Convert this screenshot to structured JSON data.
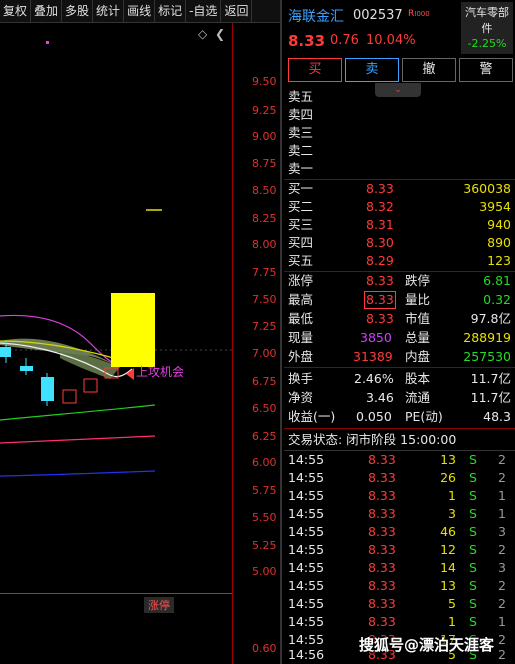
{
  "toolbar": [
    "复权",
    "叠加",
    "多股",
    "统计",
    "画线",
    "标记",
    "-自选",
    "返回"
  ],
  "stock": {
    "name": "海联金汇",
    "code": "002537",
    "badge": "R",
    "price": "8.33",
    "change": "0.76",
    "change_pct": "10.04%",
    "sector_name": "汽车零部件",
    "sector_pct": "-2.25%"
  },
  "actions": {
    "buy": "买",
    "sell": "卖",
    "cancel": "撤",
    "alert": "警"
  },
  "chart": {
    "y_ticks": [
      "9.50",
      "9.25",
      "9.00",
      "8.75",
      "8.50",
      "8.25",
      "8.00",
      "7.75",
      "7.50",
      "7.25",
      "7.00",
      "6.75",
      "6.50",
      "6.25",
      "6.00",
      "5.75",
      "5.50",
      "5.25",
      "5.00"
    ],
    "volume_tick": "0.60",
    "annotation": "上攻机会",
    "limit_tag": "涨停",
    "diamond": "◇",
    "scroll": "❮"
  },
  "sell_levels": [
    "卖五",
    "卖四",
    "卖三",
    "卖二",
    "卖一"
  ],
  "buy_levels": [
    {
      "label": "买一",
      "price": "8.33",
      "vol": "360038"
    },
    {
      "label": "买二",
      "price": "8.32",
      "vol": "3954"
    },
    {
      "label": "买三",
      "price": "8.31",
      "vol": "940"
    },
    {
      "label": "买四",
      "price": "8.30",
      "vol": "890"
    },
    {
      "label": "买五",
      "price": "8.29",
      "vol": "123"
    }
  ],
  "stats": [
    {
      "l1": "涨停",
      "v1": "8.33",
      "l2": "跌停",
      "v2": "6.81"
    },
    {
      "l1": "最高",
      "v1": "8.33",
      "l2": "量比",
      "v2": "0.32"
    },
    {
      "l1": "最低",
      "v1": "8.33",
      "l2": "市值",
      "v2": "97.8亿"
    },
    {
      "l1": "现量",
      "v1": "3850",
      "l2": "总量",
      "v2": "288919"
    },
    {
      "l1": "外盘",
      "v1": "31389",
      "l2": "内盘",
      "v2": "257530"
    }
  ],
  "fundamentals": [
    {
      "l1": "换手",
      "v1": "2.46%",
      "l2": "股本",
      "v2": "11.7亿"
    },
    {
      "l1": "净资",
      "v1": "3.46",
      "l2": "流通",
      "v2": "11.7亿"
    },
    {
      "l1": "收益(一)",
      "v1": "0.050",
      "l2": "PE(动)",
      "v2": "48.3"
    }
  ],
  "trade_status": "交易状态: 闭市阶段 15:00:00",
  "ticks": [
    {
      "time": "14:55",
      "price": "8.33",
      "vol": "13",
      "side": "S",
      "n": "2"
    },
    {
      "time": "14:55",
      "price": "8.33",
      "vol": "26",
      "side": "S",
      "n": "2"
    },
    {
      "time": "14:55",
      "price": "8.33",
      "vol": "1",
      "side": "S",
      "n": "1"
    },
    {
      "time": "14:55",
      "price": "8.33",
      "vol": "3",
      "side": "S",
      "n": "1"
    },
    {
      "time": "14:55",
      "price": "8.33",
      "vol": "46",
      "side": "S",
      "n": "3"
    },
    {
      "time": "14:55",
      "price": "8.33",
      "vol": "12",
      "side": "S",
      "n": "2"
    },
    {
      "time": "14:55",
      "price": "8.33",
      "vol": "14",
      "side": "S",
      "n": "3"
    },
    {
      "time": "14:55",
      "price": "8.33",
      "vol": "13",
      "side": "S",
      "n": "2"
    },
    {
      "time": "14:55",
      "price": "8.33",
      "vol": "5",
      "side": "S",
      "n": "2"
    },
    {
      "time": "14:55",
      "price": "8.33",
      "vol": "1",
      "side": "S",
      "n": "1"
    },
    {
      "time": "14:55",
      "price": "8.33",
      "vol": "17",
      "side": "S",
      "n": "2"
    },
    {
      "time": "14:56",
      "price": "8.33",
      "vol": "5",
      "side": "S",
      "n": "2"
    }
  ],
  "watermark": "搜狐号@漂泊天涯客",
  "colors": {
    "up": "#ff3a3a",
    "down": "#22dd22",
    "bg": "#000000",
    "limit": "#ffff00"
  }
}
